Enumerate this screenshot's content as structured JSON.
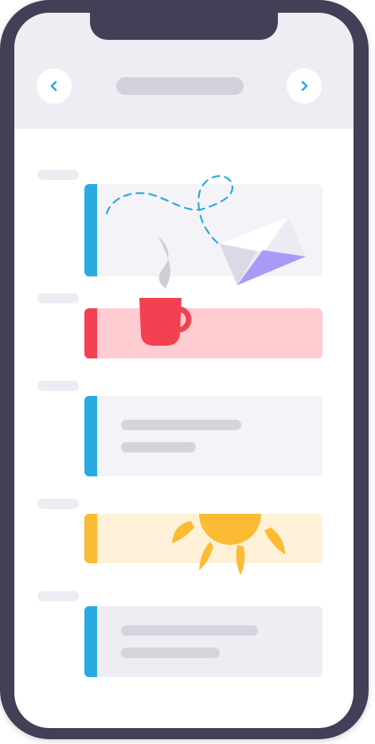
{
  "header": {
    "title": "",
    "prev_icon": "chevron-left-icon",
    "next_icon": "chevron-right-icon"
  },
  "colors": {
    "frame": "#433f57",
    "header_bg": "#efedf3",
    "blue_accent": "#29abe2",
    "red_accent": "#f24150",
    "red_card": "#ffccd2",
    "yellow_accent": "#fbbb32",
    "yellow_card": "#fff1d8",
    "gray_card": "#f4f3f8",
    "envelope_purple": "#a89bf6"
  },
  "events": [
    {
      "slot": "",
      "color": "blue",
      "illustration": "envelope-icon"
    },
    {
      "slot": "",
      "color": "red",
      "illustration": "coffee-cup-icon"
    },
    {
      "slot": "",
      "color": "blue",
      "illustration": ""
    },
    {
      "slot": "",
      "color": "yellow",
      "illustration": "sun-icon"
    },
    {
      "slot": "",
      "color": "blue",
      "illustration": ""
    }
  ]
}
